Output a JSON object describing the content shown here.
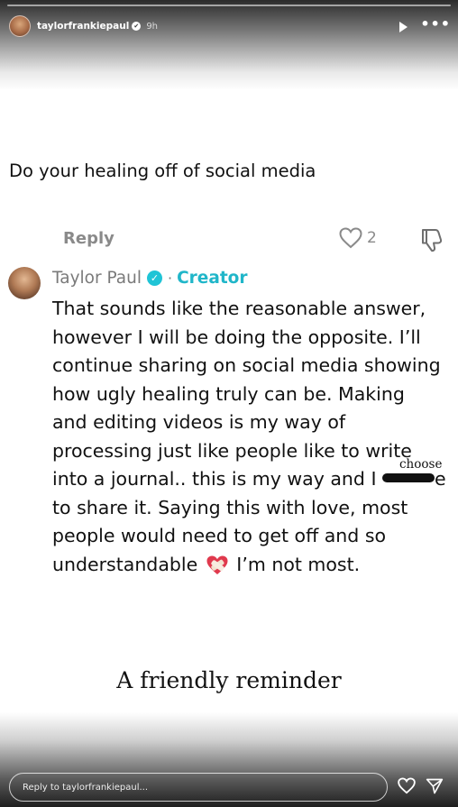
{
  "header": {
    "username": "taylorfrankiepaul",
    "time": "9h"
  },
  "question": {
    "text": "Do your healing off of social media"
  },
  "reply_row": {
    "reply_label": "Reply",
    "like_count": "2"
  },
  "comment": {
    "author": "Taylor Paul",
    "dot": "·",
    "badge": "Creator",
    "lines": [
      "That sounds like the reasonable answer,",
      "however I will be doing the opposite. I’ll",
      "continue sharing on social media showing",
      "how ugly healing truly can be. Making",
      "and editing videos is my way of",
      "processing just like people like to write",
      "into a journal.. this is my way and I",
      "e",
      "to share it. Saying this with love, most",
      "people would need to get off and so",
      "understandable",
      "I’m not most."
    ],
    "handwritten_correction": "choose"
  },
  "caption": {
    "text": "A friendly reminder"
  },
  "footer": {
    "reply_placeholder": "Reply to taylorfrankiepaul..."
  },
  "colors": {
    "creator_accent": "#20b6c9",
    "verified_badge": "#20c4d6",
    "muted_text": "#8a8a8a"
  },
  "icons": {
    "header": [
      "verified-icon",
      "play-icon",
      "more-icon"
    ],
    "reply_row": [
      "heart-icon",
      "dislike-icon"
    ],
    "comment": [
      "verified-badge-icon",
      "mending-heart-emoji"
    ],
    "footer": [
      "heart-icon",
      "send-icon"
    ]
  }
}
